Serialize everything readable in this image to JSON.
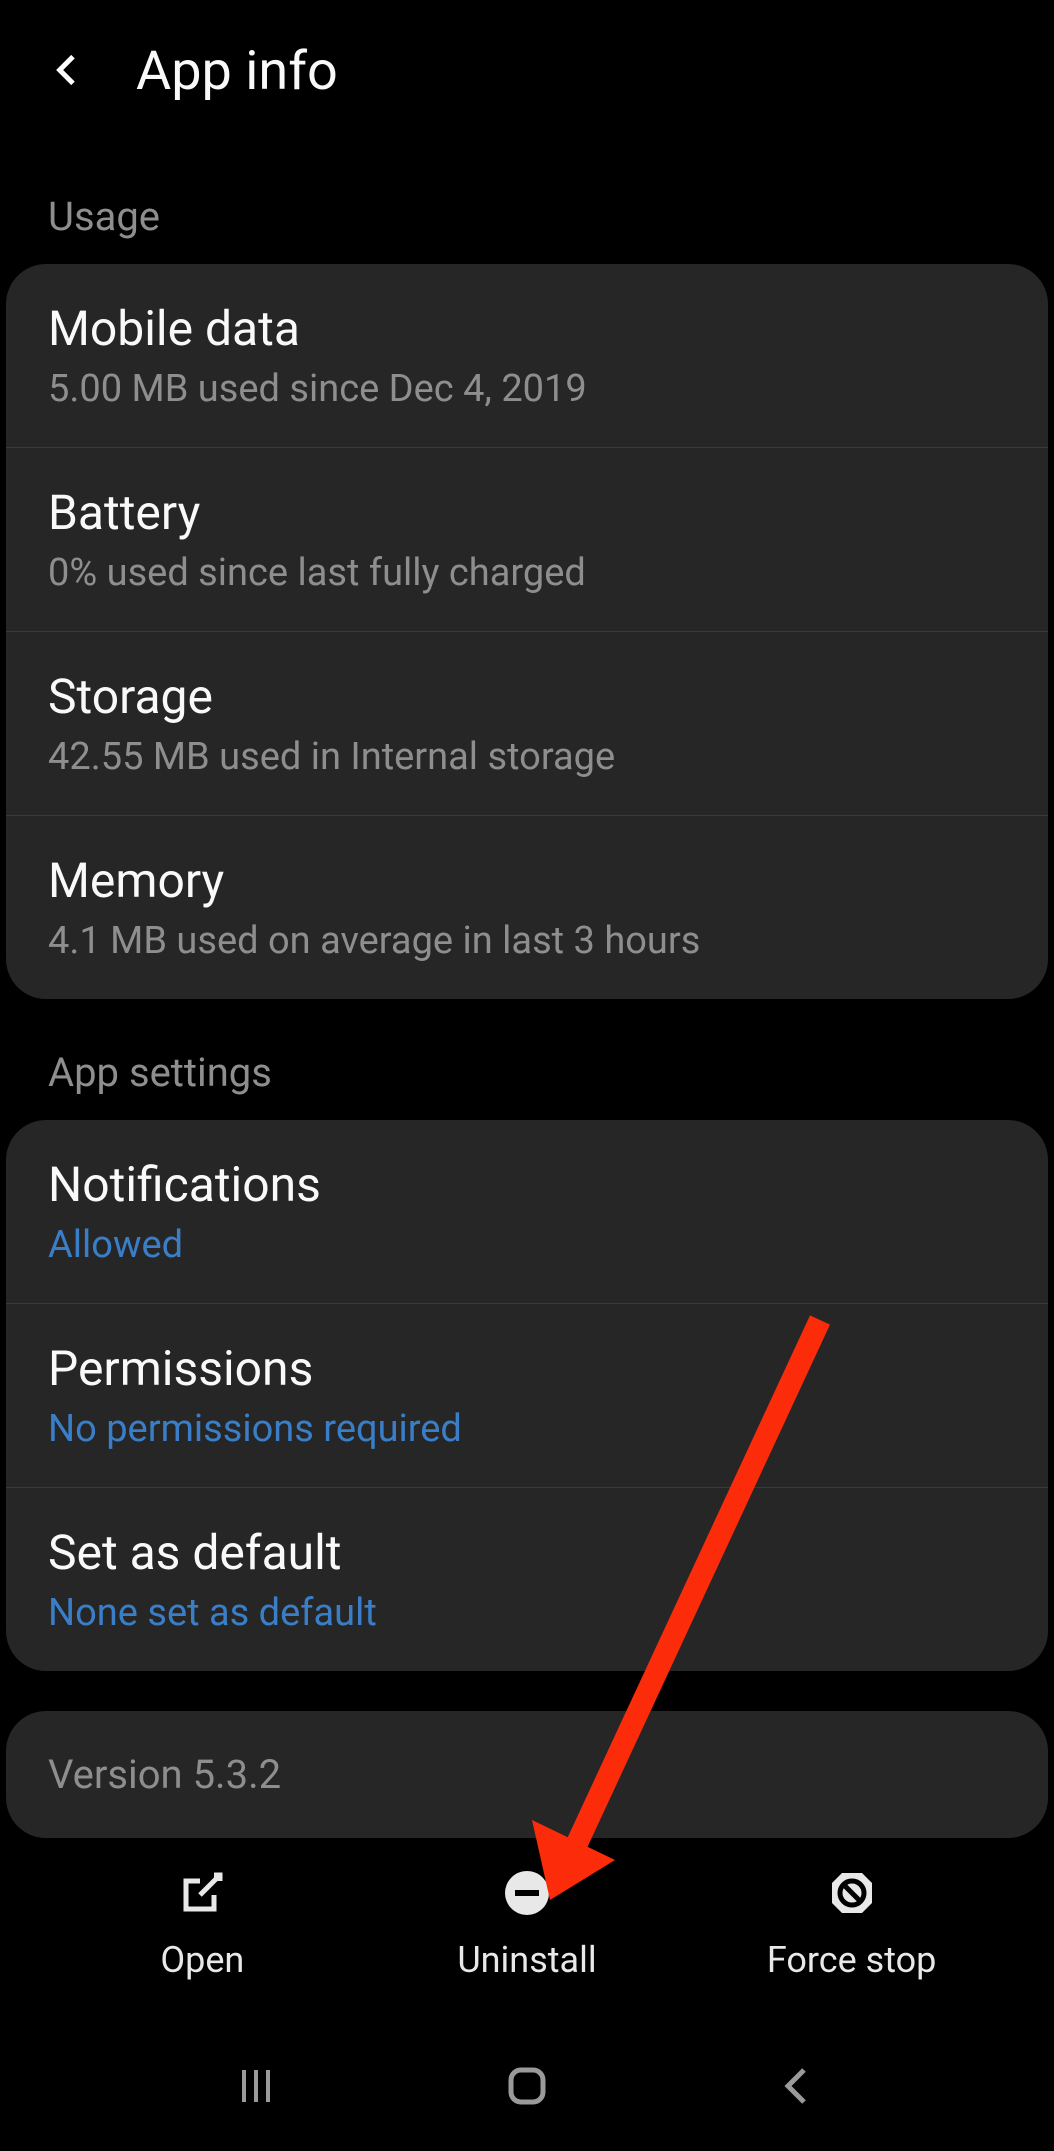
{
  "header": {
    "title": "App info"
  },
  "sections": {
    "usage": {
      "label": "Usage",
      "items": [
        {
          "title": "Mobile data",
          "subtitle": "5.00 MB used since Dec 4, 2019"
        },
        {
          "title": "Battery",
          "subtitle": "0% used since last fully charged"
        },
        {
          "title": "Storage",
          "subtitle": "42.55 MB used in Internal storage"
        },
        {
          "title": "Memory",
          "subtitle": "4.1 MB used on average in last 3 hours"
        }
      ]
    },
    "app_settings": {
      "label": "App settings",
      "items": [
        {
          "title": "Notifications",
          "subtitle": "Allowed"
        },
        {
          "title": "Permissions",
          "subtitle": "No permissions required"
        },
        {
          "title": "Set as default",
          "subtitle": "None set as default"
        }
      ]
    }
  },
  "version": "Version 5.3.2",
  "bottom_actions": {
    "open": "Open",
    "uninstall": "Uninstall",
    "force_stop": "Force stop"
  },
  "colors": {
    "accent_blue": "#3a7ec7",
    "annotation_red": "#fc2c0b"
  }
}
